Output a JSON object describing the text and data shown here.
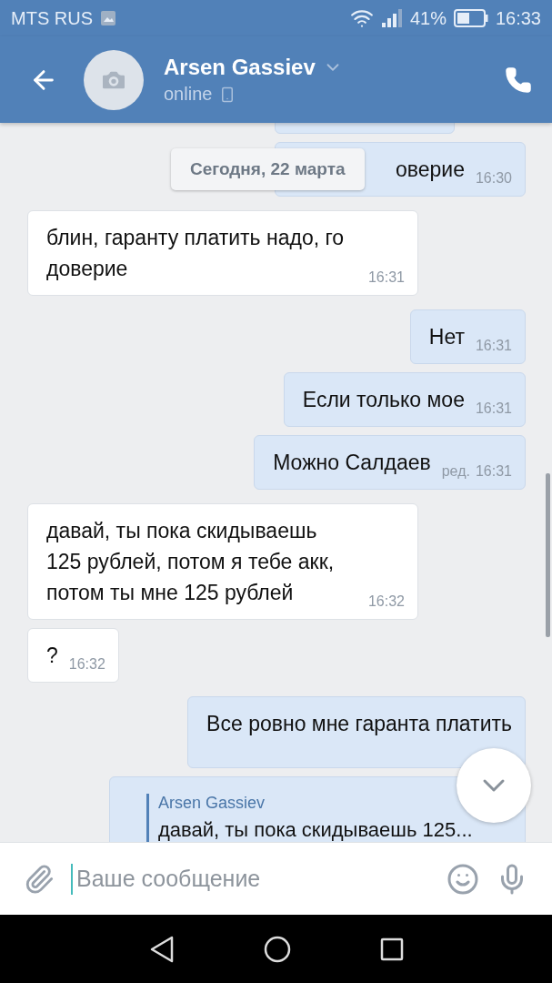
{
  "status_bar": {
    "carrier": "MTS RUS",
    "battery": "41%",
    "time": "16:33"
  },
  "header": {
    "name": "Arsen Gassiev",
    "status": "online"
  },
  "date_badge": "Сегодня, 22 марта",
  "messages": [
    {
      "kind": "clipped",
      "outgoing": true
    },
    {
      "kind": "partial",
      "outgoing": true,
      "text": "оверие",
      "time": "16:30"
    },
    {
      "kind": "text",
      "outgoing": false,
      "text": "блин, гаранту платить надо, го доверие",
      "time": "16:31"
    },
    {
      "kind": "text",
      "outgoing": true,
      "text": "Нет",
      "time": "16:31"
    },
    {
      "kind": "text",
      "outgoing": true,
      "text": "Если только мое",
      "time": "16:31"
    },
    {
      "kind": "text",
      "outgoing": true,
      "text": "Можно Салдаев",
      "edited": "ред.",
      "time": "16:31"
    },
    {
      "kind": "text",
      "outgoing": false,
      "text": "давай, ты пока скидываешь 125 рублей, потом я тебе акк, потом ты мне 125 рублей",
      "time": "16:32"
    },
    {
      "kind": "text",
      "outgoing": false,
      "text": "?",
      "time": "16:32"
    },
    {
      "kind": "text",
      "outgoing": true,
      "text": "Все ровно мне гаранта платить"
    },
    {
      "kind": "reply",
      "outgoing": true,
      "quote_author": "Arsen Gassiev",
      "quote_text": "давай, ты пока скидываешь 125..."
    }
  ],
  "input": {
    "placeholder": "Ваше сообщение"
  }
}
